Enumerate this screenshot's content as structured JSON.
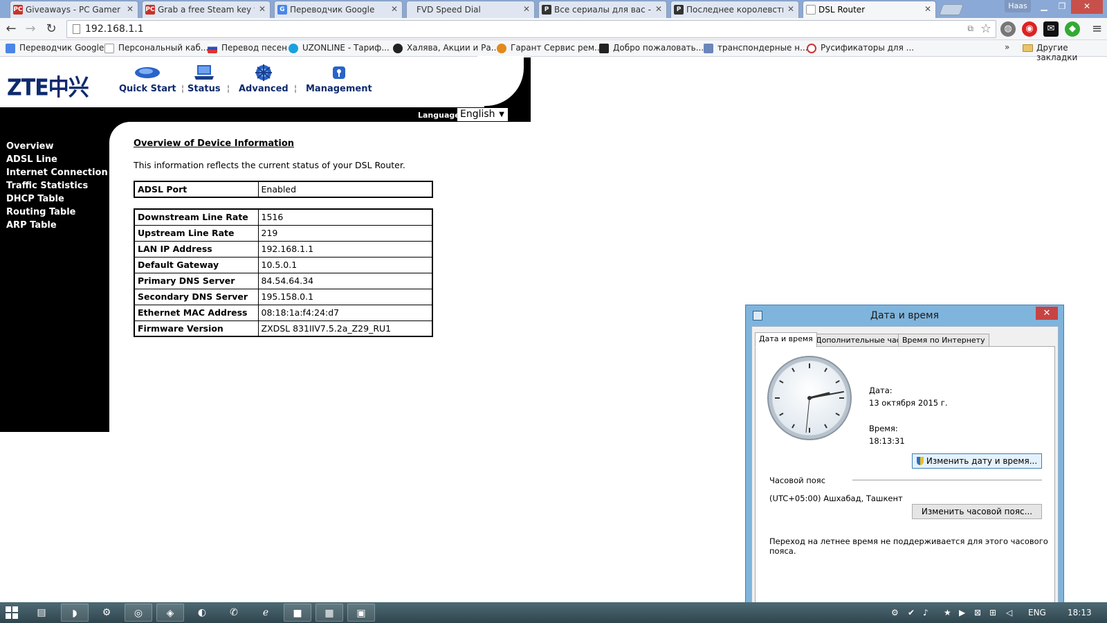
{
  "browser": {
    "tabs": [
      {
        "label": "Giveaways - PC Gamer",
        "favicon": "PC",
        "color": "#c7332b"
      },
      {
        "label": "Grab a free Steam key for",
        "favicon": "PC",
        "color": "#c7332b"
      },
      {
        "label": "Переводчик Google",
        "favicon": "G",
        "color": "#4a86e8"
      },
      {
        "label": "FVD Speed Dial",
        "favicon": "",
        "color": "#9ab3d6"
      },
      {
        "label": "Все сериалы для вас - Pi",
        "favicon": "P",
        "color": "#333333"
      },
      {
        "label": "Последнее королевство",
        "favicon": "P",
        "color": "#333333"
      },
      {
        "label": "DSL Router",
        "favicon": "",
        "color": "#dddddd"
      }
    ],
    "user_badge": "Haas",
    "address": "192.168.1.1",
    "bookmarks": [
      {
        "label": "Переводчик Google",
        "color": "#4a86e8"
      },
      {
        "label": "Персональный каб...",
        "color": "#ffffff"
      },
      {
        "label": "Перевод песен",
        "color": "#d33"
      },
      {
        "label": "UZONLINE - Тариф...",
        "color": "#1aa0e0"
      },
      {
        "label": "Халява, Акции и Ра...",
        "color": "#222222"
      },
      {
        "label": "Гарант Сервис рем...",
        "color": "#e28a1a"
      },
      {
        "label": "Добро пожаловать...",
        "color": "#222222"
      },
      {
        "label": "транспондерные н...",
        "color": "#6b86b8"
      },
      {
        "label": "Русификаторы для ...",
        "color": "#c33"
      }
    ],
    "bookmarks_more": "»",
    "other_bookmarks": "Другие закладки"
  },
  "router": {
    "logo": "ZTE中兴",
    "nav": [
      {
        "label": "Quick Start",
        "icon": "mouse-icon"
      },
      {
        "label": "Status",
        "icon": "laptop-icon"
      },
      {
        "label": "Advanced",
        "icon": "gear-globe-icon"
      },
      {
        "label": "Management",
        "icon": "tool-icon"
      }
    ],
    "language_label": "Language:",
    "language_value": "English",
    "sidebar": [
      "Overview",
      "ADSL Line",
      "Internet Connection",
      "Traffic Statistics",
      "DHCP Table",
      "Routing Table",
      "ARP Table"
    ],
    "title": "Overview of Device Information",
    "description": "This information reflects the current status of your DSL Router.",
    "adsl": [
      {
        "key": "ADSL Port",
        "value": "Enabled"
      }
    ],
    "details": [
      {
        "key": "Downstream Line Rate",
        "value": "1516"
      },
      {
        "key": "Upstream Line Rate",
        "value": "219"
      },
      {
        "key": "LAN IP Address",
        "value": "192.168.1.1"
      },
      {
        "key": "Default Gateway",
        "value": "10.5.0.1"
      },
      {
        "key": "Primary DNS Server",
        "value": "84.54.64.34"
      },
      {
        "key": "Secondary DNS Server",
        "value": "195.158.0.1"
      },
      {
        "key": "Ethernet MAC Address",
        "value": "08:18:1a:f4:24:d7"
      },
      {
        "key": "Firmware Version",
        "value": "ZXDSL 831IIV7.5.2a_Z29_RU1"
      }
    ]
  },
  "dialog": {
    "title": "Дата и время",
    "tabs": [
      "Дата и время",
      "Дополнительные часы",
      "Время по Интернету"
    ],
    "date_label": "Дата:",
    "date_value": "13 октября 2015 г.",
    "time_label": "Время:",
    "time_value": "18:13:31",
    "change_datetime_button": "Изменить дату и время...",
    "timezone_label": "Часовой пояс",
    "timezone_value": "(UTC+05:00) Ашхабад, Ташкент",
    "change_timezone_button": "Изменить часовой пояс...",
    "dst_note": "Переход на летнее время не поддерживается для этого часового пояса."
  },
  "taskbar": {
    "language": "ENG",
    "clock": "18:13"
  }
}
